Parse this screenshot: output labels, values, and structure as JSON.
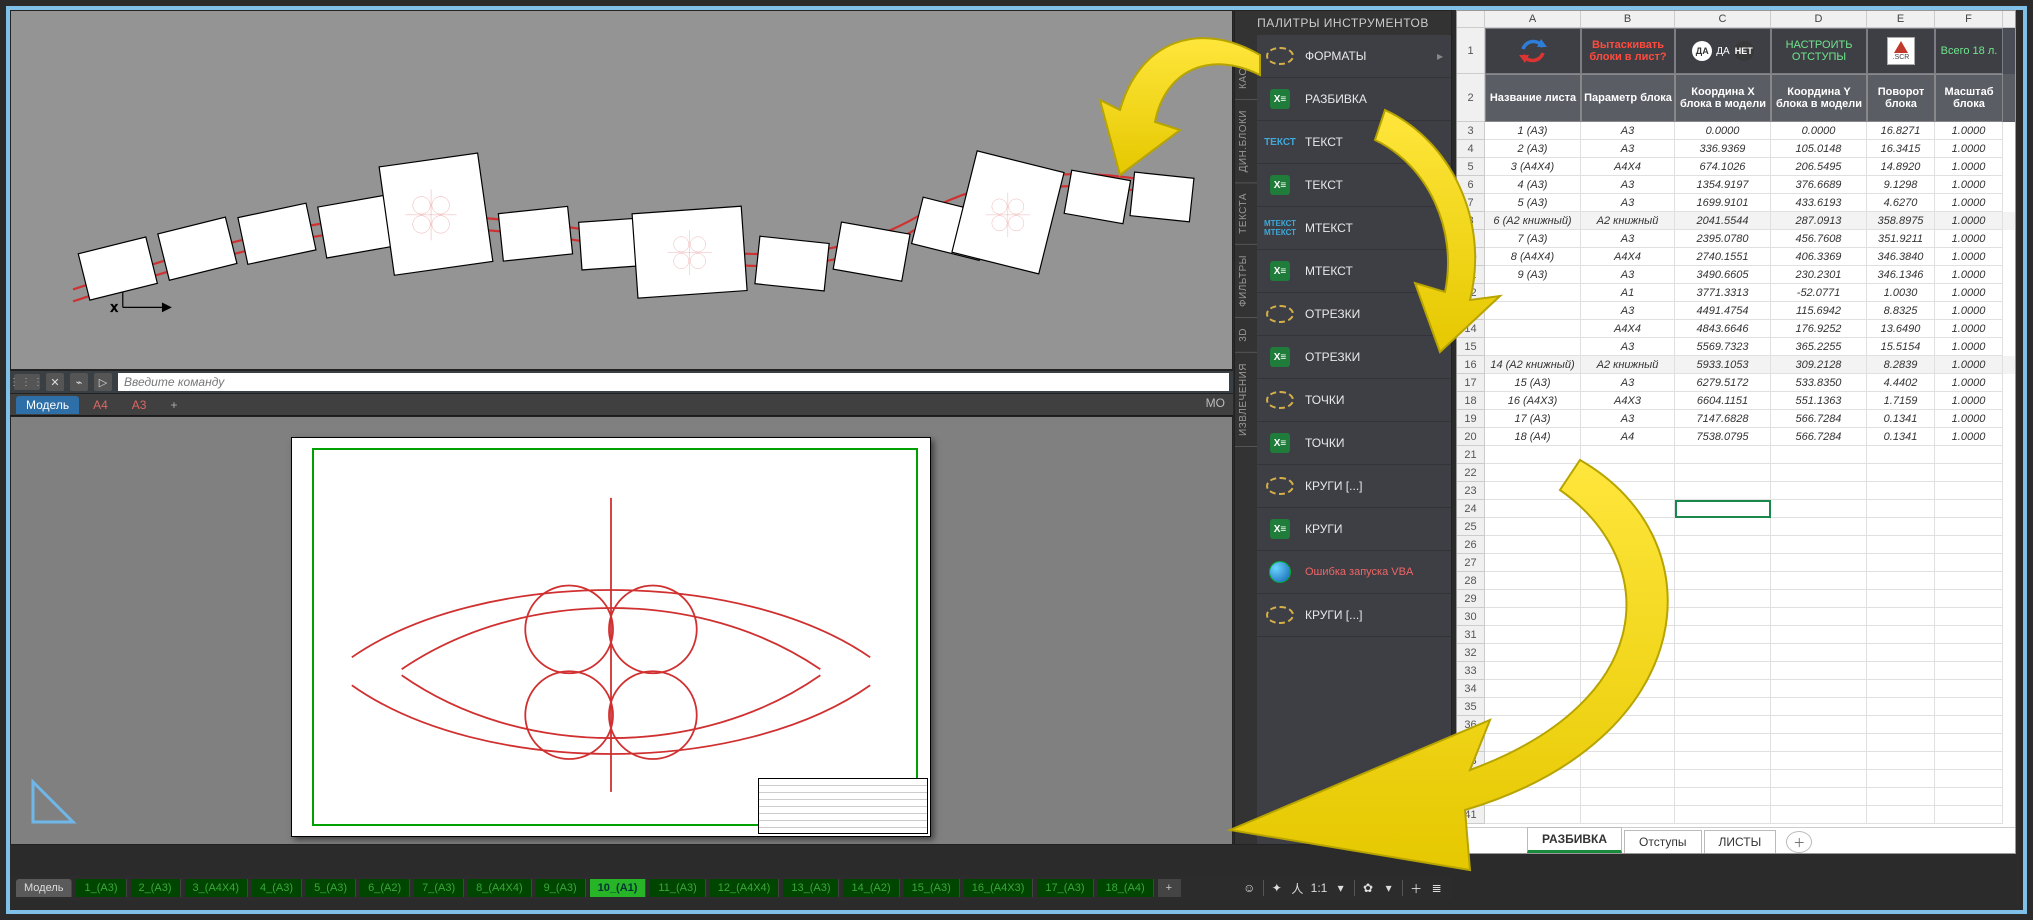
{
  "palette": {
    "title": "ПАЛИТРЫ ИНСТРУМЕНТОВ",
    "side_tabs": [
      "КАСТОМ",
      "ДИН.БЛОКИ",
      "ТЕКСТА",
      "ФИЛЬТРЫ",
      "3D",
      "ИЗВЛЕЧЕНИЯ"
    ],
    "items": [
      {
        "label": "ФОРМАТЫ",
        "icon": "lasso",
        "chev": true
      },
      {
        "label": "РАЗБИВКА",
        "icon": "xl"
      },
      {
        "label": "ТЕКСТ",
        "icon": "text"
      },
      {
        "label": "ТЕКСТ",
        "icon": "xl"
      },
      {
        "label": "МТЕКСТ",
        "icon": "mtext"
      },
      {
        "label": "МТЕКСТ",
        "icon": "xl"
      },
      {
        "label": "ОТРЕЗКИ",
        "icon": "lasso"
      },
      {
        "label": "ОТРЕЗКИ",
        "icon": "xl"
      },
      {
        "label": "ТОЧКИ",
        "icon": "lasso"
      },
      {
        "label": "ТОЧКИ",
        "icon": "xl"
      },
      {
        "label": "КРУГИ [...]",
        "icon": "lasso"
      },
      {
        "label": "КРУГИ",
        "icon": "xl"
      },
      {
        "label": "Ошибка запуска VBA",
        "icon": "globe",
        "vba": true
      },
      {
        "label": "КРУГИ [...]",
        "icon": "lasso"
      }
    ]
  },
  "cad": {
    "cmd_placeholder": "Введите команду",
    "subtabs": [
      {
        "label": "Модель",
        "cls": "active"
      },
      {
        "label": "А4",
        "cls": "red"
      },
      {
        "label": "А3",
        "cls": "red"
      },
      {
        "label": "+",
        "cls": "plus"
      }
    ],
    "mo_label": "МО",
    "bottom_tabs": [
      {
        "label": "Модель",
        "cls": "model"
      },
      {
        "label": "1_(А3)"
      },
      {
        "label": "2_(А3)"
      },
      {
        "label": "3_(А4Х4)"
      },
      {
        "label": "4_(А3)"
      },
      {
        "label": "5_(А3)"
      },
      {
        "label": "6_(А2)"
      },
      {
        "label": "7_(А3)"
      },
      {
        "label": "8_(А4Х4)"
      },
      {
        "label": "9_(А3)"
      },
      {
        "label": "10_(А1)",
        "cls": "active"
      },
      {
        "label": "11_(А3)"
      },
      {
        "label": "12_(А4Х4)"
      },
      {
        "label": "13_(А3)"
      },
      {
        "label": "14_(А2)"
      },
      {
        "label": "15_(А3)"
      },
      {
        "label": "16_(А4Х3)"
      },
      {
        "label": "17_(А3)"
      },
      {
        "label": "18_(А4)"
      },
      {
        "label": "+",
        "cls": "plus"
      }
    ],
    "status_ratio": "1:1"
  },
  "sheet": {
    "columns": [
      "",
      "A",
      "B",
      "C",
      "D",
      "E",
      "F"
    ],
    "topbar": {
      "pull_q": "Вытаскивать блоки в лист?",
      "da_caption": "ДА",
      "da": "ДА",
      "het": "НЕТ",
      "configure": "НАСТРОИТЬ ОТСТУПЫ",
      "scr": ".SCR",
      "total": "Всего 18 л."
    },
    "head": [
      "Название листа",
      "Параметр блока",
      "Координа X блока в модели",
      "Координа Y блока в модели",
      "Поворот блока",
      "Масштаб блока"
    ],
    "rows": [
      {
        "r": 3,
        "c": [
          "1 (А3)",
          "А3",
          "0.0000",
          "0.0000",
          "16.8271",
          "1.0000"
        ]
      },
      {
        "r": 4,
        "c": [
          "2 (А3)",
          "А3",
          "336.9369",
          "105.0148",
          "16.3415",
          "1.0000"
        ]
      },
      {
        "r": 5,
        "c": [
          "3 (А4Х4)",
          "А4Х4",
          "674.1026",
          "206.5495",
          "14.8920",
          "1.0000"
        ]
      },
      {
        "r": 6,
        "c": [
          "4 (А3)",
          "А3",
          "1354.9197",
          "376.6689",
          "9.1298",
          "1.0000"
        ]
      },
      {
        "r": 7,
        "c": [
          "5 (А3)",
          "А3",
          "1699.9101",
          "433.6193",
          "4.6270",
          "1.0000"
        ]
      },
      {
        "r": 8,
        "c": [
          "6 (А2 книжный)",
          "А2 книжный",
          "2041.5544",
          "287.0913",
          "358.8975",
          "1.0000"
        ],
        "hl": true
      },
      {
        "r": 9,
        "c": [
          "7 (А3)",
          "А3",
          "2395.0780",
          "456.7608",
          "351.9211",
          "1.0000"
        ]
      },
      {
        "r": 10,
        "c": [
          "8 (А4Х4)",
          "А4Х4",
          "2740.1551",
          "406.3369",
          "346.3840",
          "1.0000"
        ]
      },
      {
        "r": 11,
        "c": [
          "9 (А3)",
          "А3",
          "3490.6605",
          "230.2301",
          "346.1346",
          "1.0000"
        ]
      },
      {
        "r": 12,
        "c": [
          "",
          "А1",
          "3771.3313",
          "-52.0771",
          "1.0030",
          "1.0000"
        ]
      },
      {
        "r": 13,
        "c": [
          "",
          "А3",
          "4491.4754",
          "115.6942",
          "8.8325",
          "1.0000"
        ]
      },
      {
        "r": 14,
        "c": [
          "",
          "А4Х4",
          "4843.6646",
          "176.9252",
          "13.6490",
          "1.0000"
        ]
      },
      {
        "r": 15,
        "c": [
          "",
          "А3",
          "5569.7323",
          "365.2255",
          "15.5154",
          "1.0000"
        ]
      },
      {
        "r": 16,
        "c": [
          "14 (А2 книжный)",
          "А2 книжный",
          "5933.1053",
          "309.2128",
          "8.2839",
          "1.0000"
        ],
        "hl": true
      },
      {
        "r": 17,
        "c": [
          "15 (А3)",
          "А3",
          "6279.5172",
          "533.8350",
          "4.4402",
          "1.0000"
        ]
      },
      {
        "r": 18,
        "c": [
          "16 (А4Х3)",
          "А4Х3",
          "6604.1151",
          "551.1363",
          "1.7159",
          "1.0000"
        ]
      },
      {
        "r": 19,
        "c": [
          "17 (А3)",
          "А3",
          "7147.6828",
          "566.7284",
          "0.1341",
          "1.0000"
        ]
      },
      {
        "r": 20,
        "c": [
          "18 (А4)",
          "А4",
          "7538.0795",
          "566.7284",
          "0.1341",
          "1.0000"
        ]
      }
    ],
    "empty_rows": [
      21,
      22,
      23,
      24,
      25,
      26,
      27,
      28,
      29,
      30,
      31,
      32,
      33,
      34,
      35,
      36,
      37,
      38,
      39,
      40,
      41
    ],
    "selected": {
      "row": 24,
      "col": 2
    },
    "tabs": [
      {
        "label": "РАЗБИВКА",
        "active": true
      },
      {
        "label": "Отступы"
      },
      {
        "label": "ЛИСТЫ"
      }
    ]
  }
}
